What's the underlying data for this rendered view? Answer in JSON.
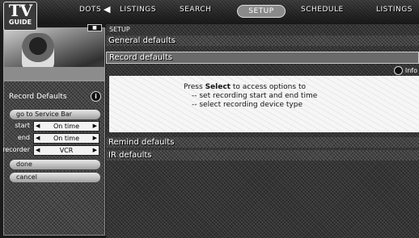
{
  "logo": {
    "tv": "TV",
    "guide": "GUIDE"
  },
  "nav": {
    "dots": "DOTS",
    "items": [
      "LISTINGS",
      "SEARCH",
      "SETUP",
      "SCHEDULE",
      "LISTINGS"
    ],
    "active": "SETUP"
  },
  "left_panel": {
    "title": "Record Defaults",
    "service_bar": "go to Service Bar",
    "rows": [
      {
        "label": "start",
        "value": "On time"
      },
      {
        "label": "end",
        "value": "On time"
      },
      {
        "label": "recorder",
        "value": "VCR"
      }
    ],
    "done": "done",
    "cancel": "cancel"
  },
  "content": {
    "breadcrumb": "SETUP",
    "sections": {
      "general": "General defaults",
      "record": "Record defaults",
      "remind": "Remind defaults",
      "ir": "IR defaults"
    },
    "info_label": "Info",
    "message": {
      "line1_prefix": "Press ",
      "line1_bold": "Select",
      "line1_suffix": " to access options to",
      "line2": "-- set recording start and end time",
      "line3": "-- select recording device type"
    }
  },
  "colors": {
    "bar": "#6b6b6b",
    "panel": "#555555",
    "text_box": "#f6f6f6"
  }
}
